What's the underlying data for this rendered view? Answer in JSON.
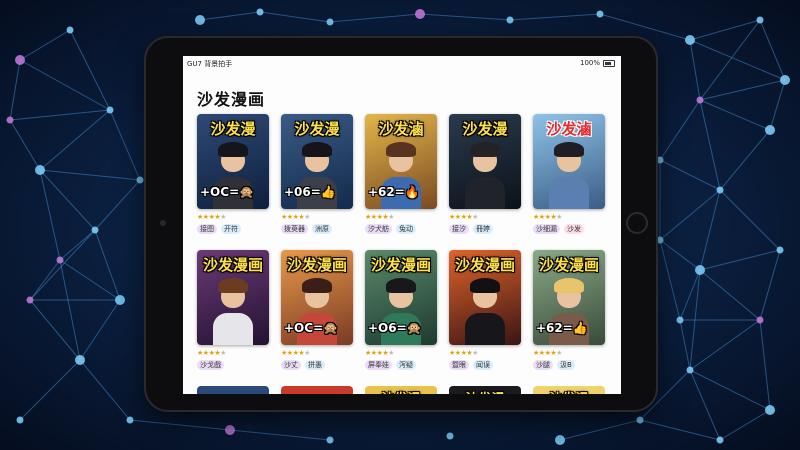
{
  "status_bar": {
    "left": "GU7 背景拍手",
    "right": "100%"
  },
  "page": {
    "title": "沙发漫画"
  },
  "cards": [
    {
      "title": "沙发漫",
      "title_style": "yellow",
      "badge": "+OC=🙊",
      "bg": [
        "#2e4a78",
        "#0e1f3a"
      ],
      "hair": "#15151c",
      "body": "#2f3038",
      "rating": 4,
      "tags": [
        {
          "text": "接图",
          "color": "purple"
        },
        {
          "text": "开符",
          "color": "blue"
        }
      ]
    },
    {
      "title": "沙发漫",
      "title_style": "yellow",
      "badge": "+06=👍",
      "bg": [
        "#3a5b86",
        "#132a4a"
      ],
      "hair": "#14141a",
      "body": "#3a3f4a",
      "rating": 4,
      "tags": [
        {
          "text": "拨萸器",
          "color": "purple"
        },
        {
          "text": "洲原",
          "color": "blue"
        }
      ]
    },
    {
      "title": "沙发滷",
      "title_style": "yellow",
      "badge": "+62=🔥",
      "bg": [
        "#e3b64a",
        "#7a4a22"
      ],
      "hair": "#5a3320",
      "body": "#3d6bb0",
      "rating": 4,
      "tags": [
        {
          "text": "汐犬舫",
          "color": "purple"
        },
        {
          "text": "兔动",
          "color": "blue"
        }
      ]
    },
    {
      "title": "沙发漫",
      "title_style": "yellow",
      "badge": "",
      "bg": [
        "#2a3a4e",
        "#0c1219"
      ],
      "hair": "#232327",
      "body": "#202329",
      "rating": 4,
      "tags": [
        {
          "text": "接汐",
          "color": "purple"
        },
        {
          "text": "冊婷",
          "color": "blue"
        }
      ]
    },
    {
      "title": "沙发滷",
      "title_style": "red",
      "badge": "",
      "bg": [
        "#8fc3e8",
        "#3a5d84"
      ],
      "hair": "#1e1e24",
      "body": "#5b7fb0",
      "rating": 4,
      "tags": [
        {
          "text": "沙细漏",
          "color": "purple"
        },
        {
          "text": "沙发",
          "color": "pink"
        }
      ]
    },
    {
      "title": "沙发漫画",
      "title_style": "yellow",
      "badge": "",
      "bg": [
        "#6a3a78",
        "#241230"
      ],
      "hair": "#6b3b22",
      "body": "#e6e6ea",
      "rating": 4,
      "tags": [
        {
          "text": "沙戈戲",
          "color": "purple"
        }
      ]
    },
    {
      "title": "沙发漫画",
      "title_style": "yellow",
      "badge": "+OC=🙊",
      "bg": [
        "#e89a4a",
        "#7a3a24"
      ],
      "hair": "#3a1e18",
      "body": "#c4473a",
      "rating": 4,
      "tags": [
        {
          "text": "沙丈",
          "color": "purple"
        },
        {
          "text": "拼愚",
          "color": "blue"
        }
      ]
    },
    {
      "title": "沙发漫画",
      "title_style": "yellow",
      "badge": "+O6=🙊",
      "bg": [
        "#5a8a6a",
        "#1e3a30"
      ],
      "hair": "#17171c",
      "body": "#2f7a5a",
      "rating": 4,
      "tags": [
        {
          "text": "屏奉娃",
          "color": "purple"
        },
        {
          "text": "泻疑",
          "color": "blue"
        }
      ]
    },
    {
      "title": "沙发漫画",
      "title_style": "yellow",
      "badge": "",
      "bg": [
        "#e0642a",
        "#3a1414"
      ],
      "hair": "#111114",
      "body": "#17171b",
      "rating": 4,
      "tags": [
        {
          "text": "暨眼",
          "color": "purple"
        },
        {
          "text": "闻误",
          "color": "blue"
        }
      ]
    },
    {
      "title": "沙发漫画",
      "title_style": "yellow",
      "badge": "+62=👍",
      "bg": [
        "#8aaa88",
        "#3a4a3a"
      ],
      "hair": "#e8c46a",
      "body": "#7a5a4a",
      "rating": 4,
      "tags": [
        {
          "text": "沙腿",
          "color": "purple"
        },
        {
          "text": "汲B",
          "color": "blue"
        }
      ]
    }
  ],
  "row3": [
    {
      "bg": "#2a4a7a",
      "title": ""
    },
    {
      "bg": "#c83a2a",
      "title": ""
    },
    {
      "bg": "#e8c24a",
      "title": "沙发漫"
    },
    {
      "bg": "#1a1a1f",
      "title": "沙发漫"
    },
    {
      "bg": "#f0d36a",
      "title": "沙发漫"
    }
  ],
  "colors": {
    "screen_bg": "#fdfdfd",
    "star": "#e0a412",
    "title_yellow": "#ffe14a",
    "title_red": "#e8262b"
  },
  "icons": [
    "battery-icon",
    "star-icon"
  ]
}
